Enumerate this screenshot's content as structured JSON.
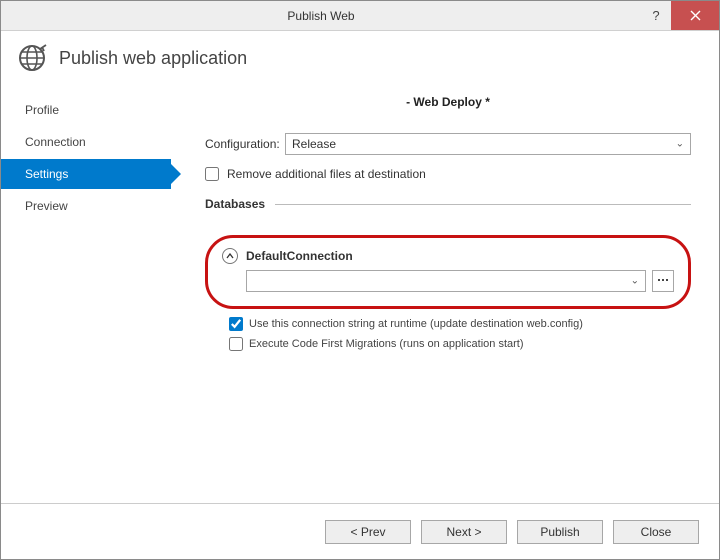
{
  "window": {
    "title": "Publish Web"
  },
  "header": {
    "title": "Publish web application"
  },
  "sidebar": {
    "items": [
      {
        "label": "Profile"
      },
      {
        "label": "Connection"
      },
      {
        "label": "Settings"
      },
      {
        "label": "Preview"
      }
    ],
    "activeIndex": 2
  },
  "main": {
    "deployTitle": "- Web Deploy *",
    "configLabel": "Configuration:",
    "configValue": "Release",
    "removeFilesLabel": "Remove additional files at destination",
    "removeFilesChecked": false,
    "databasesHeading": "Databases",
    "defaultConnection": {
      "name": "DefaultConnection",
      "connectionString": "",
      "useRuntimeLabel": "Use this connection string at runtime (update destination web.config)",
      "useRuntimeChecked": true,
      "migrationsLabel": "Execute Code First Migrations (runs on application start)",
      "migrationsChecked": false
    }
  },
  "footer": {
    "prev": "< Prev",
    "next": "Next >",
    "publish": "Publish",
    "close": "Close"
  }
}
